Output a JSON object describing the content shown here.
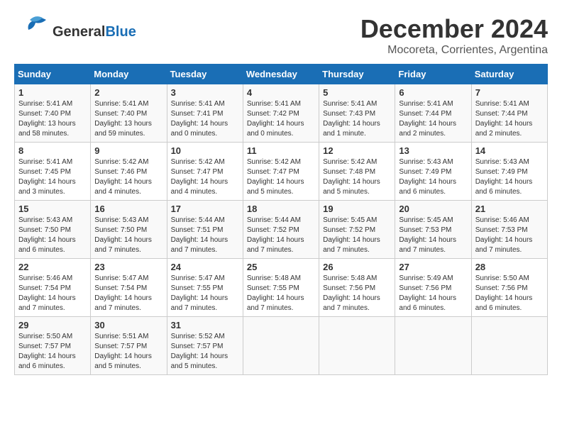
{
  "header": {
    "logo_general": "General",
    "logo_blue": "Blue",
    "title": "December 2024",
    "subtitle": "Mocoreta, Corrientes, Argentina"
  },
  "weekdays": [
    "Sunday",
    "Monday",
    "Tuesday",
    "Wednesday",
    "Thursday",
    "Friday",
    "Saturday"
  ],
  "weeks": [
    [
      {
        "day": 1,
        "sunrise": "5:41 AM",
        "sunset": "7:40 PM",
        "daylight": "13 hours and 58 minutes."
      },
      {
        "day": 2,
        "sunrise": "5:41 AM",
        "sunset": "7:40 PM",
        "daylight": "13 hours and 59 minutes."
      },
      {
        "day": 3,
        "sunrise": "5:41 AM",
        "sunset": "7:41 PM",
        "daylight": "14 hours and 0 minutes."
      },
      {
        "day": 4,
        "sunrise": "5:41 AM",
        "sunset": "7:42 PM",
        "daylight": "14 hours and 0 minutes."
      },
      {
        "day": 5,
        "sunrise": "5:41 AM",
        "sunset": "7:43 PM",
        "daylight": "14 hours and 1 minute."
      },
      {
        "day": 6,
        "sunrise": "5:41 AM",
        "sunset": "7:44 PM",
        "daylight": "14 hours and 2 minutes."
      },
      {
        "day": 7,
        "sunrise": "5:41 AM",
        "sunset": "7:44 PM",
        "daylight": "14 hours and 2 minutes."
      }
    ],
    [
      {
        "day": 8,
        "sunrise": "5:41 AM",
        "sunset": "7:45 PM",
        "daylight": "14 hours and 3 minutes."
      },
      {
        "day": 9,
        "sunrise": "5:42 AM",
        "sunset": "7:46 PM",
        "daylight": "14 hours and 4 minutes."
      },
      {
        "day": 10,
        "sunrise": "5:42 AM",
        "sunset": "7:47 PM",
        "daylight": "14 hours and 4 minutes."
      },
      {
        "day": 11,
        "sunrise": "5:42 AM",
        "sunset": "7:47 PM",
        "daylight": "14 hours and 5 minutes."
      },
      {
        "day": 12,
        "sunrise": "5:42 AM",
        "sunset": "7:48 PM",
        "daylight": "14 hours and 5 minutes."
      },
      {
        "day": 13,
        "sunrise": "5:43 AM",
        "sunset": "7:49 PM",
        "daylight": "14 hours and 6 minutes."
      },
      {
        "day": 14,
        "sunrise": "5:43 AM",
        "sunset": "7:49 PM",
        "daylight": "14 hours and 6 minutes."
      }
    ],
    [
      {
        "day": 15,
        "sunrise": "5:43 AM",
        "sunset": "7:50 PM",
        "daylight": "14 hours and 6 minutes."
      },
      {
        "day": 16,
        "sunrise": "5:43 AM",
        "sunset": "7:50 PM",
        "daylight": "14 hours and 7 minutes."
      },
      {
        "day": 17,
        "sunrise": "5:44 AM",
        "sunset": "7:51 PM",
        "daylight": "14 hours and 7 minutes."
      },
      {
        "day": 18,
        "sunrise": "5:44 AM",
        "sunset": "7:52 PM",
        "daylight": "14 hours and 7 minutes."
      },
      {
        "day": 19,
        "sunrise": "5:45 AM",
        "sunset": "7:52 PM",
        "daylight": "14 hours and 7 minutes."
      },
      {
        "day": 20,
        "sunrise": "5:45 AM",
        "sunset": "7:53 PM",
        "daylight": "14 hours and 7 minutes."
      },
      {
        "day": 21,
        "sunrise": "5:46 AM",
        "sunset": "7:53 PM",
        "daylight": "14 hours and 7 minutes."
      }
    ],
    [
      {
        "day": 22,
        "sunrise": "5:46 AM",
        "sunset": "7:54 PM",
        "daylight": "14 hours and 7 minutes."
      },
      {
        "day": 23,
        "sunrise": "5:47 AM",
        "sunset": "7:54 PM",
        "daylight": "14 hours and 7 minutes."
      },
      {
        "day": 24,
        "sunrise": "5:47 AM",
        "sunset": "7:55 PM",
        "daylight": "14 hours and 7 minutes."
      },
      {
        "day": 25,
        "sunrise": "5:48 AM",
        "sunset": "7:55 PM",
        "daylight": "14 hours and 7 minutes."
      },
      {
        "day": 26,
        "sunrise": "5:48 AM",
        "sunset": "7:56 PM",
        "daylight": "14 hours and 7 minutes."
      },
      {
        "day": 27,
        "sunrise": "5:49 AM",
        "sunset": "7:56 PM",
        "daylight": "14 hours and 6 minutes."
      },
      {
        "day": 28,
        "sunrise": "5:50 AM",
        "sunset": "7:56 PM",
        "daylight": "14 hours and 6 minutes."
      }
    ],
    [
      {
        "day": 29,
        "sunrise": "5:50 AM",
        "sunset": "7:57 PM",
        "daylight": "14 hours and 6 minutes."
      },
      {
        "day": 30,
        "sunrise": "5:51 AM",
        "sunset": "7:57 PM",
        "daylight": "14 hours and 5 minutes."
      },
      {
        "day": 31,
        "sunrise": "5:52 AM",
        "sunset": "7:57 PM",
        "daylight": "14 hours and 5 minutes."
      },
      null,
      null,
      null,
      null
    ]
  ]
}
